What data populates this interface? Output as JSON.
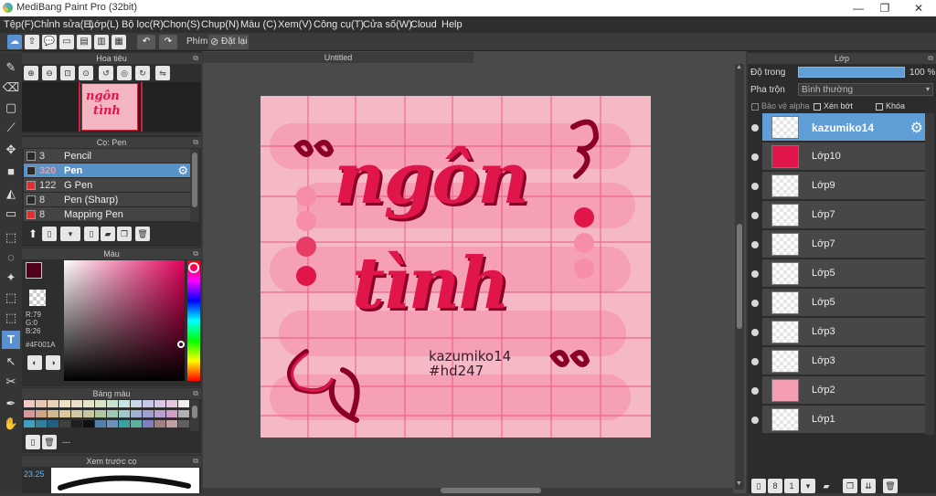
{
  "app": {
    "title": "MediBang Paint Pro (32bit)",
    "window_controls": [
      "—",
      "❐",
      "✕"
    ]
  },
  "menu": [
    "Tệp(F)",
    "Chỉnh sửa(E)",
    "Lớp(L)",
    "Bộ lọc(R)",
    "Chọn(S)",
    "Chụp(N)",
    "Màu (C)",
    "Xem(V)",
    "Công cụ(T)",
    "Cửa số(W)",
    "Cloud",
    "Help"
  ],
  "toolbar": {
    "shortcut_label": "Phím",
    "reset_label": "Đặt lại"
  },
  "navigator": {
    "title": "Hoa tiêu"
  },
  "brush": {
    "title": "Cọ: Pen",
    "items": [
      {
        "size": "3",
        "name": "Pencil",
        "color": "#2a2a2a"
      },
      {
        "size": "320",
        "name": "Pen",
        "color": "#2a2a2a"
      },
      {
        "size": "122",
        "name": "G Pen",
        "color": "#e03030"
      },
      {
        "size": "8",
        "name": "Pen (Sharp)",
        "color": "#2a2a2a"
      },
      {
        "size": "8",
        "name": "Mapping Pen",
        "color": "#e03030"
      }
    ]
  },
  "color": {
    "title": "Màu",
    "r": "R:79",
    "g": "G:0",
    "b": "B:26",
    "hex": "#4F001A",
    "main": "#4f001a"
  },
  "palette": {
    "title": "Bảng màu",
    "extra": "---"
  },
  "brush_preview": {
    "title": "Xem trước cọ",
    "size": "23.25"
  },
  "document": {
    "tab": "Untitled"
  },
  "layers_panel": {
    "title": "Lớp",
    "opacity_label": "Độ trong",
    "opacity_value": "100 %",
    "blend_label": "Pha trộn",
    "blend_value": "Bình thường",
    "alpha_protect": "Bảo vệ alpha",
    "clip": "Xén bớt",
    "lock": "Khóa"
  },
  "layers": [
    {
      "name": "kazumiko14",
      "selected": true
    },
    {
      "name": "Lớp10"
    },
    {
      "name": "Lớp9"
    },
    {
      "name": "Lớp7"
    },
    {
      "name": "Lớp7"
    },
    {
      "name": "Lớp5"
    },
    {
      "name": "Lớp5"
    },
    {
      "name": "Lớp3"
    },
    {
      "name": "Lớp3"
    },
    {
      "name": "Lớp2"
    },
    {
      "name": "Lớp1"
    }
  ],
  "artwork": {
    "line1": "ngôn",
    "line2": "tình",
    "signature1": "kazumiko14",
    "signature2": "#hd247"
  },
  "colors": {
    "accent": "#5f9ed6",
    "pink_bg": "#f3b5c2",
    "text_red": "#e0154a"
  }
}
